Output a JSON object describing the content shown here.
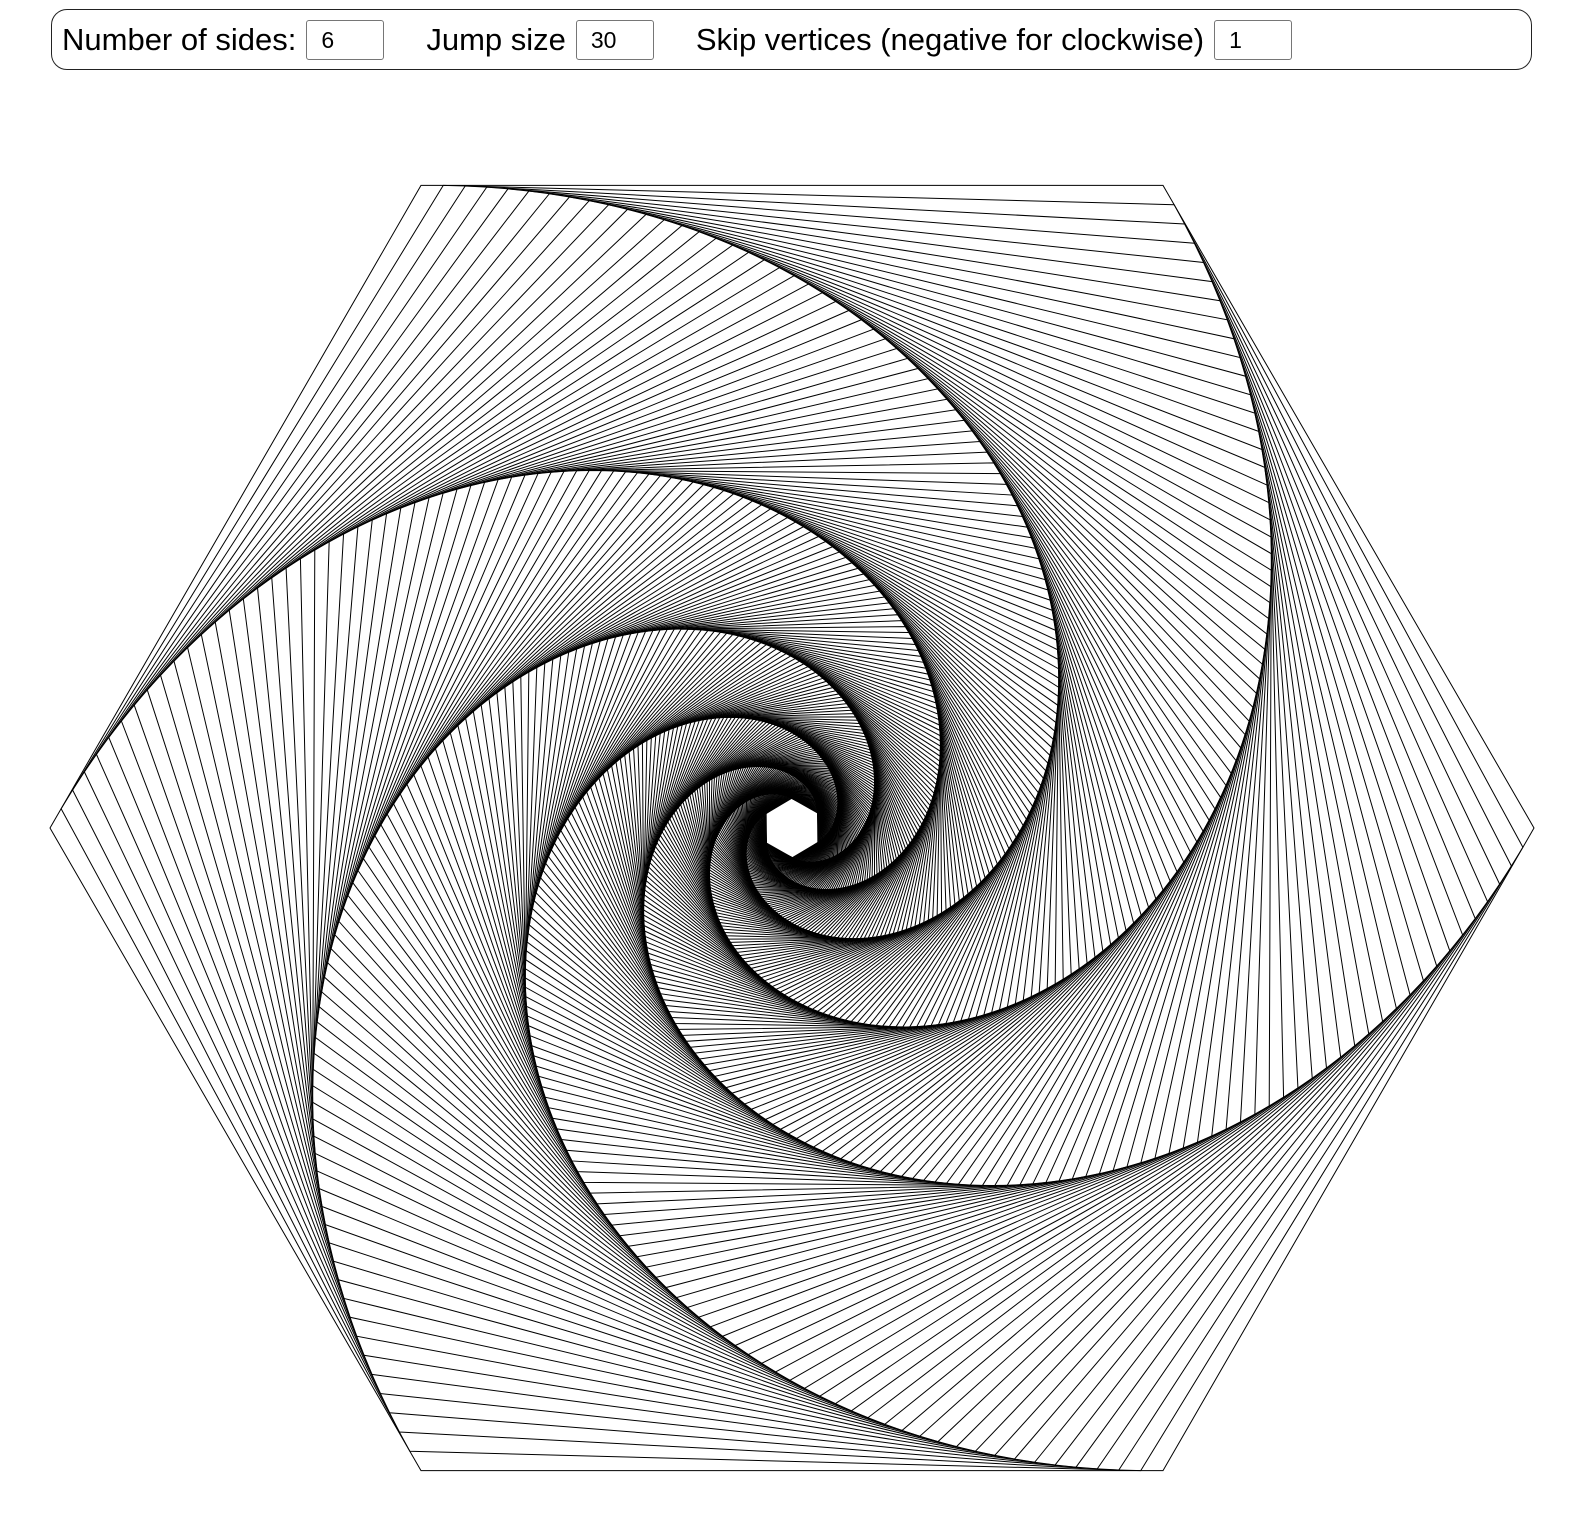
{
  "controls": {
    "sides": {
      "label": "Number of sides:",
      "value": "6"
    },
    "jump": {
      "label": "Jump size",
      "value": "30"
    },
    "skip": {
      "label": "Skip vertices (negative for clockwise)",
      "value": "1"
    }
  },
  "drawing": {
    "line_color": "#000000",
    "background": "#ffffff"
  }
}
